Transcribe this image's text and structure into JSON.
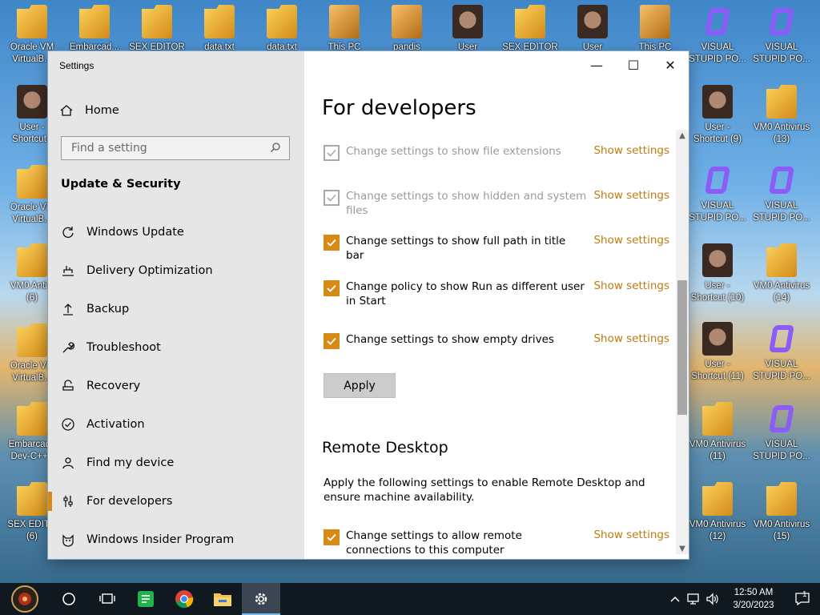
{
  "desktop": {
    "left_icons": [
      {
        "label": "Oracle VM\nVirtualB..."
      },
      {
        "label": "User -\nShortcut ("
      },
      {
        "label": "Oracle VM\nVirtualB..."
      },
      {
        "label": "VM0 Antivi\n(6)"
      },
      {
        "label": "Oracle VM\nVirtualB..."
      },
      {
        "label": "Embarcade\nDev-C++ ("
      },
      {
        "label": "SEX EDITO\n(6)"
      }
    ],
    "top_labels": [
      "Embarcad...",
      "SEX EDITOR",
      "data.txt",
      "data.txt",
      "This PC",
      "pandis",
      "User",
      "SEX EDITOR",
      "User",
      "This PC"
    ],
    "right_icons_col1": [
      {
        "label": "VISUAL\nSTUPID PO..."
      },
      {
        "label": "User -\nShortcut (9)"
      },
      {
        "label": "VISUAL\nSTUPID PO..."
      },
      {
        "label": "User -\nShortcut (10)"
      },
      {
        "label": "User -\nShortcut (11)"
      },
      {
        "label": "VM0 Antivirus\n(11)"
      },
      {
        "label": "VM0 Antivirus\n(12)"
      }
    ],
    "right_icons_col2": [
      {
        "label": "VISUAL\nSTUPID PO..."
      },
      {
        "label": "VM0 Antivirus\n(13)"
      },
      {
        "label": "VISUAL\nSTUPID PO..."
      },
      {
        "label": "VM0 Antivirus\n(14)"
      },
      {
        "label": "VISUAL\nSTUPID PO..."
      },
      {
        "label": "VISUAL\nSTUPID PO..."
      },
      {
        "label": "VM0 Antivirus\n(15)"
      }
    ]
  },
  "window": {
    "title": "Settings",
    "controls": {
      "minimize": "—",
      "maximize": "☐",
      "close": "✕"
    }
  },
  "nav": {
    "home_label": "Home",
    "search_placeholder": "Find a setting",
    "section": "Update & Security",
    "items": [
      {
        "label": "Windows Update",
        "icon": "refresh-icon"
      },
      {
        "label": "Delivery Optimization",
        "icon": "delivery-icon"
      },
      {
        "label": "Backup",
        "icon": "backup-icon"
      },
      {
        "label": "Troubleshoot",
        "icon": "wrench-icon"
      },
      {
        "label": "Recovery",
        "icon": "recovery-icon"
      },
      {
        "label": "Activation",
        "icon": "check-circle-icon"
      },
      {
        "label": "Find my device",
        "icon": "person-pin-icon"
      },
      {
        "label": "For developers",
        "icon": "sliders-icon"
      },
      {
        "label": "Windows Insider Program",
        "icon": "cat-icon"
      }
    ]
  },
  "content": {
    "title": "For developers",
    "options": [
      {
        "text": "Change settings to show file extensions",
        "link": "Show settings",
        "state": "disabled"
      },
      {
        "text": "Change settings to show hidden and system files",
        "link": "Show settings",
        "state": "disabled"
      },
      {
        "text": "Change settings to show full path in title bar",
        "link": "Show settings",
        "state": "checked"
      },
      {
        "text": "Change policy to show Run as different user in Start",
        "link": "Show settings",
        "state": "checked"
      },
      {
        "text": "Change settings to show empty drives",
        "link": "Show settings",
        "state": "checked"
      }
    ],
    "apply_label": "Apply",
    "remote_title": "Remote Desktop",
    "remote_desc": "Apply the following settings to enable Remote Desktop and ensure machine availability.",
    "remote_option": {
      "text": "Change settings to allow remote connections to this computer",
      "link": "Show settings",
      "state": "checked"
    }
  },
  "taskbar": {
    "time": "12:50 AM",
    "date": "3/20/2023",
    "notification_count": "1"
  },
  "colors": {
    "accent": "#d88a16",
    "link": "#c07a10",
    "nav_bg": "#e6e6e6",
    "taskbar": "#101820"
  }
}
